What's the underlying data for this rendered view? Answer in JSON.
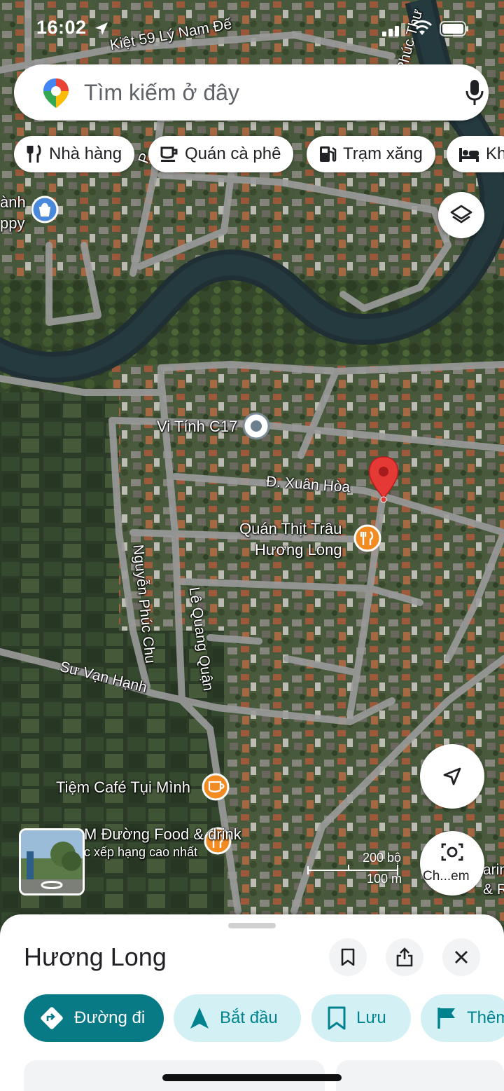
{
  "status_bar": {
    "time": "16:02"
  },
  "search": {
    "placeholder": "Tìm kiếm ở đây"
  },
  "chips": [
    {
      "label": "Nhà hàng",
      "icon": "fork-knife-icon"
    },
    {
      "label": "Quán cà phê",
      "icon": "coffee-icon"
    },
    {
      "label": "Trạm xăng",
      "icon": "gas-station-icon"
    },
    {
      "label": "Kh",
      "icon": "bed-icon"
    }
  ],
  "map_labels": {
    "top_street": "Kiệt 59 Lý Nam Đế",
    "river_street": "Phúc Thư",
    "left_poi_line1": "ành",
    "left_poi_line2": "ppy",
    "small_road": "P",
    "vi_tinh": "Vi Tính C17",
    "xuan_hoa": "Đ. Xuân Hòa",
    "quan_thit_line1": "Quán Thịt Trâu",
    "quan_thit_line2": "Hương Long",
    "nguyen_phuc_chu": "Nguyễn Phúc Chu",
    "le_quang_quan": "Lê Quang Quận",
    "su_van_hanh": "Sư Vạn Hạnh",
    "tiem_cafe": "Tiệm Café Tụi Mình",
    "food_drink": "M  Đường Food & drink",
    "food_sub": "c xếp hạng cao nhất",
    "right_edge_1": "arin",
    "right_edge_2": "& Res",
    "camera_label": "Ch...em"
  },
  "scale": {
    "top": "200 bộ",
    "bottom": "100 m"
  },
  "place": {
    "name": "Hương Long"
  },
  "actions": [
    {
      "label": "Đường đi",
      "icon": "directions-icon"
    },
    {
      "label": "Bắt đầu",
      "icon": "navigation-arrow-icon"
    },
    {
      "label": "Lưu",
      "icon": "bookmark-icon"
    },
    {
      "label": "Thêm",
      "icon": "flag-icon"
    }
  ],
  "colors": {
    "accent": "#087a86",
    "accent_light": "#d3f0f5",
    "pin": "#e53935",
    "poi_orange": "#f28b22",
    "road": "#9b9b9b",
    "river": "#1f2f33"
  }
}
